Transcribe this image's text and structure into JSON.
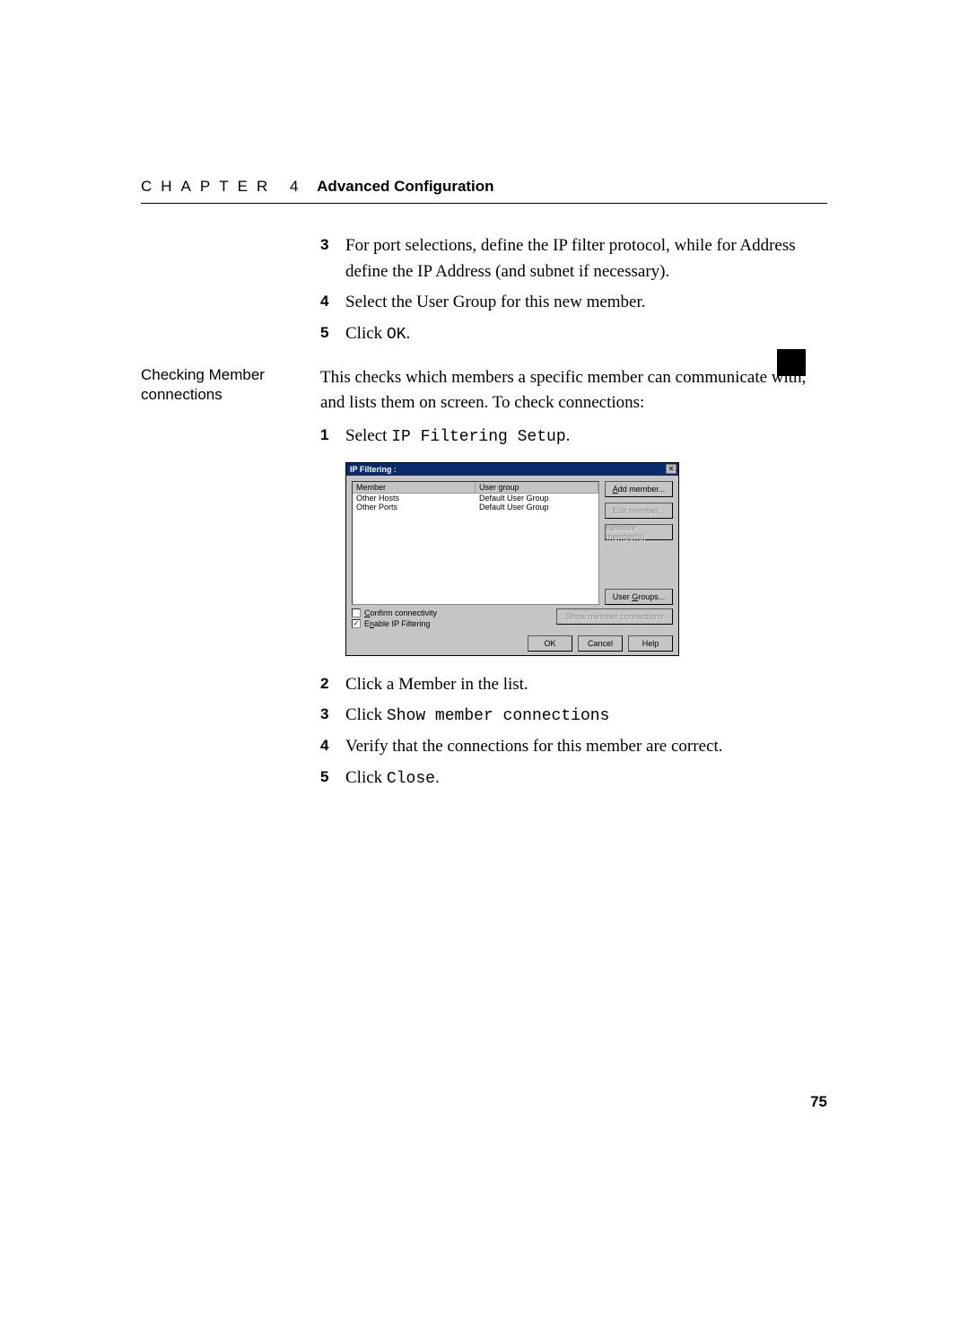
{
  "header": {
    "chapter_label": "CHAPTER 4",
    "title": "Advanced Configuration"
  },
  "page_number": "75",
  "margin_note": "Checking Member connections",
  "steps_a": {
    "s3": "For port selections, define the IP filter protocol, while for Address define the IP Address (and subnet if necessary).",
    "s4": "Select the User Group for this new member.",
    "s5_prefix": "Click ",
    "s5_code": "OK",
    "s5_suffix": "."
  },
  "intro_para": "This checks which members a specific member can communicate with, and lists them on screen. To check connections:",
  "steps_b": {
    "s1_prefix": "Select ",
    "s1_code": "IP Filtering Setup",
    "s1_suffix": ".",
    "s2": "Click a Member in the list.",
    "s3_prefix": "Click ",
    "s3_code": "Show member connections",
    "s4": "Verify that the connections for this member are correct.",
    "s5_prefix": "Click ",
    "s5_code": "Close",
    "s5_suffix": "."
  },
  "dialog": {
    "title": "IP Filtering :",
    "col_member": "Member",
    "col_group": "User group",
    "rows": [
      {
        "member": "Other Hosts",
        "group": "Default User Group"
      },
      {
        "member": "Other Ports",
        "group": "Default User Group"
      }
    ],
    "btn_add": "Add member...",
    "btn_edit": "Edit member...",
    "btn_remove": "Remove member(s)",
    "btn_groups": "User Groups...",
    "chk_confirm": "Confirm connectivity",
    "chk_enable": "Enable IP Filtering",
    "btn_show": "Show member connections",
    "btn_ok": "OK",
    "btn_cancel": "Cancel",
    "btn_help": "Help"
  }
}
